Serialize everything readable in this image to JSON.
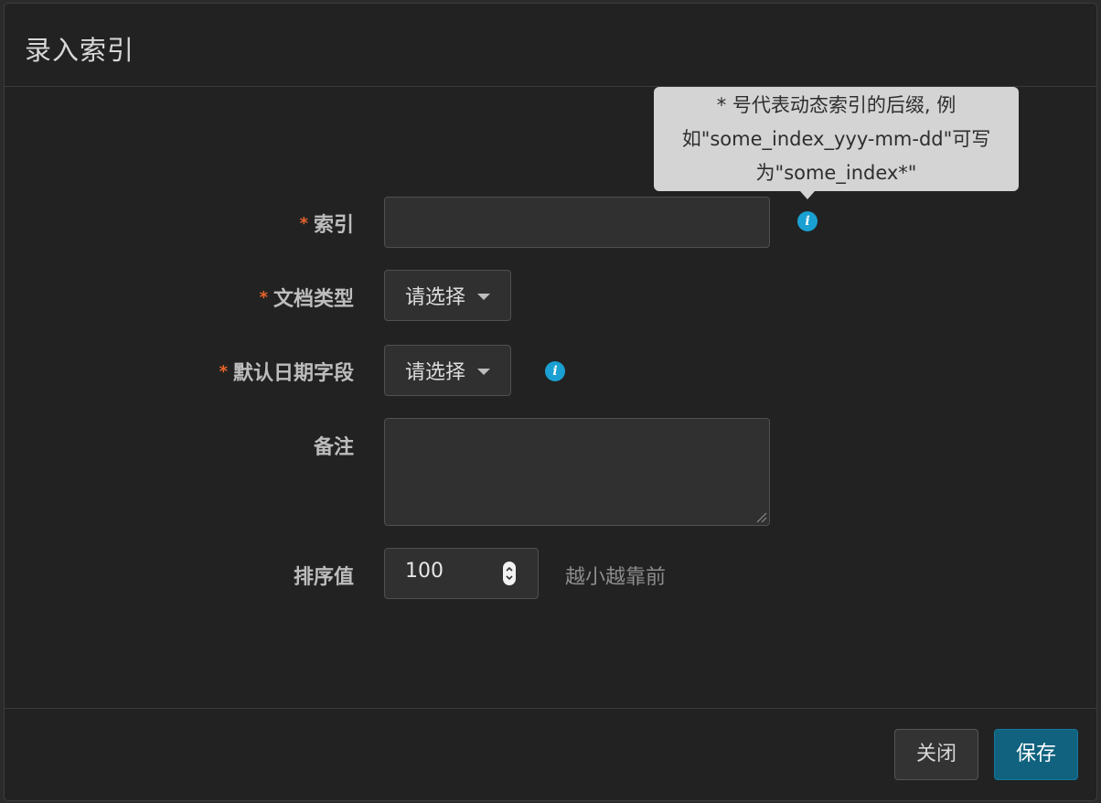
{
  "modal": {
    "title": "录入索引"
  },
  "tooltip": {
    "lines": [
      "* 号代表动态索引的后缀, 例",
      "如\"some_index_yyy-mm-dd\"可写",
      "为\"some_index*\""
    ]
  },
  "form": {
    "required_mark": "*",
    "index": {
      "label": "索引",
      "value": ""
    },
    "doc_type": {
      "label": "文档类型",
      "selected": "请选择"
    },
    "date_field": {
      "label": "默认日期字段",
      "selected": "请选择"
    },
    "remark": {
      "label": "备注",
      "value": ""
    },
    "sort": {
      "label": "排序值",
      "value": "100",
      "help": "越小越靠前"
    }
  },
  "icons": {
    "info": "i"
  },
  "footer": {
    "close_label": "关闭",
    "save_label": "保存"
  },
  "colors": {
    "required": "#e8632b",
    "info_icon": "#1aa0d2",
    "primary_button": "#10627f"
  }
}
